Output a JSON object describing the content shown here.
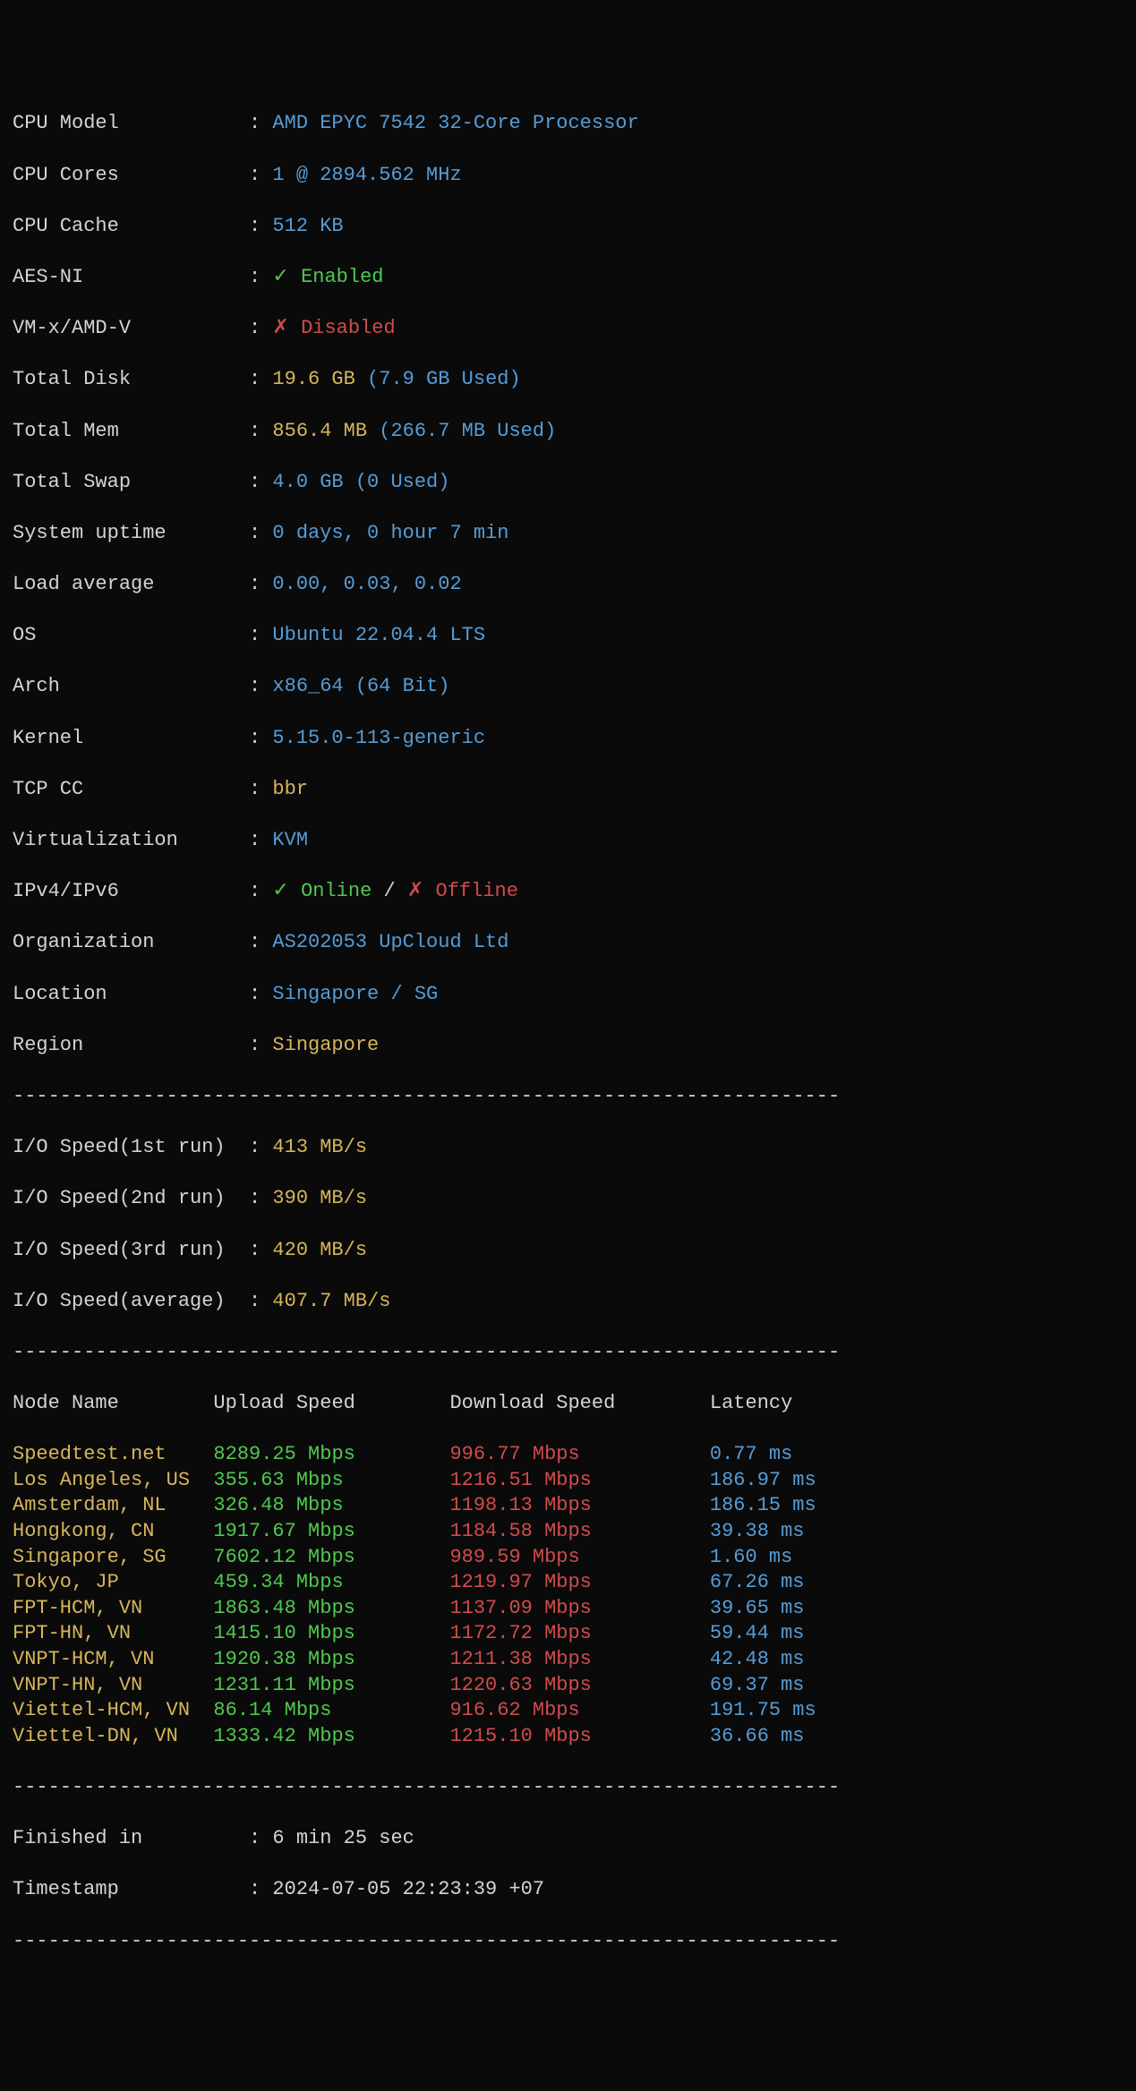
{
  "dash_line": "----------------------------------------------------------------------",
  "sys": {
    "cpu_model": {
      "label": "CPU Model",
      "value": "AMD EPYC 7542 32-Core Processor"
    },
    "cpu_cores": {
      "label": "CPU Cores",
      "value": "1 @ 2894.562 MHz"
    },
    "cpu_cache": {
      "label": "CPU Cache",
      "value": "512 KB"
    },
    "aes_ni": {
      "label": "AES-NI",
      "mark": "✓",
      "value": "Enabled"
    },
    "vmx": {
      "label": "VM-x/AMD-V",
      "mark": "✗",
      "value": "Disabled"
    },
    "total_disk": {
      "label": "Total Disk",
      "value": "19.6 GB",
      "used": "(7.9 GB Used)"
    },
    "total_mem": {
      "label": "Total Mem",
      "value": "856.4 MB",
      "used": "(266.7 MB Used)"
    },
    "total_swap": {
      "label": "Total Swap",
      "value": "4.0 GB (0 Used)"
    },
    "uptime": {
      "label": "System uptime",
      "value": "0 days, 0 hour 7 min"
    },
    "load_avg": {
      "label": "Load average",
      "value": "0.00, 0.03, 0.02"
    },
    "os": {
      "label": "OS",
      "value": "Ubuntu 22.04.4 LTS"
    },
    "arch": {
      "label": "Arch",
      "value": "x86_64 (64 Bit)"
    },
    "kernel": {
      "label": "Kernel",
      "value": "5.15.0-113-generic"
    },
    "tcp_cc": {
      "label": "TCP CC",
      "value": "bbr"
    },
    "virt": {
      "label": "Virtualization",
      "value": "KVM"
    },
    "ipver": {
      "label": "IPv4/IPv6",
      "m1": "✓",
      "v1": "Online",
      "sep": " / ",
      "m2": "✗",
      "v2": "Offline"
    },
    "org": {
      "label": "Organization",
      "value": "AS202053 UpCloud Ltd"
    },
    "location": {
      "label": "Location",
      "value": "Singapore / SG"
    },
    "region": {
      "label": "Region",
      "value": "Singapore"
    }
  },
  "io": {
    "run1": {
      "label": "I/O Speed(1st run)",
      "value": "413 MB/s"
    },
    "run2": {
      "label": "I/O Speed(2nd run)",
      "value": "390 MB/s"
    },
    "run3": {
      "label": "I/O Speed(3rd run)",
      "value": "420 MB/s"
    },
    "avg": {
      "label": "I/O Speed(average)",
      "value": "407.7 MB/s"
    }
  },
  "speed": {
    "headers": {
      "node": "Node Name",
      "up": "Upload Speed",
      "down": "Download Speed",
      "lat": "Latency"
    },
    "rows": [
      {
        "node": "Speedtest.net",
        "up": "8289.25 Mbps",
        "down": "996.77 Mbps",
        "lat": "0.77 ms"
      },
      {
        "node": "Los Angeles, US",
        "up": "355.63 Mbps",
        "down": "1216.51 Mbps",
        "lat": "186.97 ms"
      },
      {
        "node": "Amsterdam, NL",
        "up": "326.48 Mbps",
        "down": "1198.13 Mbps",
        "lat": "186.15 ms"
      },
      {
        "node": "Hongkong, CN",
        "up": "1917.67 Mbps",
        "down": "1184.58 Mbps",
        "lat": "39.38 ms"
      },
      {
        "node": "Singapore, SG",
        "up": "7602.12 Mbps",
        "down": "989.59 Mbps",
        "lat": "1.60 ms"
      },
      {
        "node": "Tokyo, JP",
        "up": "459.34 Mbps",
        "down": "1219.97 Mbps",
        "lat": "67.26 ms"
      },
      {
        "node": "FPT-HCM, VN",
        "up": "1863.48 Mbps",
        "down": "1137.09 Mbps",
        "lat": "39.65 ms"
      },
      {
        "node": "FPT-HN, VN",
        "up": "1415.10 Mbps",
        "down": "1172.72 Mbps",
        "lat": "59.44 ms"
      },
      {
        "node": "VNPT-HCM, VN",
        "up": "1920.38 Mbps",
        "down": "1211.38 Mbps",
        "lat": "42.48 ms"
      },
      {
        "node": "VNPT-HN, VN",
        "up": "1231.11 Mbps",
        "down": "1220.63 Mbps",
        "lat": "69.37 ms"
      },
      {
        "node": "Viettel-HCM, VN",
        "up": "86.14 Mbps",
        "down": "916.62 Mbps",
        "lat": "191.75 ms"
      },
      {
        "node": "Viettel-DN, VN",
        "up": "1333.42 Mbps",
        "down": "1215.10 Mbps",
        "lat": "36.66 ms"
      }
    ]
  },
  "footer": {
    "finished": {
      "label": "Finished in",
      "value": "6 min 25 sec"
    },
    "timestamp": {
      "label": "Timestamp",
      "value": "2024-07-05 22:23:39 +07"
    }
  }
}
